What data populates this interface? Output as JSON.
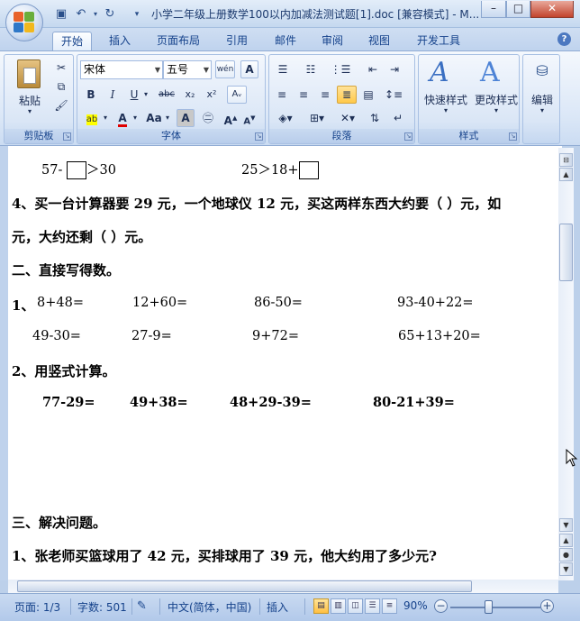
{
  "window": {
    "title": "小学二年级上册数学100以内加减法测试题[1].doc [兼容模式] - M...",
    "minimize_glyph": "–",
    "maximize_glyph": "□",
    "close_glyph": "✕"
  },
  "tabs": [
    "开始",
    "插入",
    "页面布局",
    "引用",
    "邮件",
    "审阅",
    "视图",
    "开发工具"
  ],
  "help_glyph": "?",
  "ribbon": {
    "clipboard": {
      "label": "剪贴板",
      "paste": "粘贴"
    },
    "font": {
      "label": "字体",
      "font_name": "宋体",
      "font_size": "五号",
      "wen": "wén",
      "A": "A",
      "bold": "B",
      "italic": "I",
      "underline": "U",
      "strike": "abc",
      "sub": "x₂",
      "sup": "x²",
      "aa": "Aa",
      "grow": "A",
      "shrink": "A"
    },
    "paragraph": {
      "label": "段落"
    },
    "styles": {
      "label": "样式",
      "quick": "快速样式",
      "change": "更改样式"
    },
    "editing": {
      "label": "编辑"
    }
  },
  "doc": {
    "line1_left": "57-",
    "line1_gt": "＞30",
    "line1_right": "25＞18+",
    "q4_line1": "4、买一台计算器要 29 元，一个地球仪 12 元，买这两样东西大约要（   ）元，如",
    "q4_line2": "元，大约还剩（  ）元。",
    "sec2_title": "二、直接写得数。",
    "q1_num": "1、",
    "direct_row1": [
      "8+48=",
      "12+60=",
      "86-50=",
      "93-40+22="
    ],
    "direct_row2": [
      "49-30=",
      "27-9=",
      "9+72=",
      "65+13+20="
    ],
    "q2_title": "2、用竖式计算。",
    "vertical_row": [
      "77-29=",
      "49+38=",
      "48+29-39=",
      "80-21+39="
    ],
    "sec3_title": "三、解决问题。",
    "sec3_q1": "1、张老师买篮球用了 42 元，买排球用了 39 元，他大约用了多少元?"
  },
  "status": {
    "page": "页面: 1/3",
    "words": "字数: 501",
    "lang": "中文(简体，中国)",
    "insert": "插入",
    "zoom": "90%",
    "zoom_minus": "−",
    "zoom_plus": "+"
  }
}
